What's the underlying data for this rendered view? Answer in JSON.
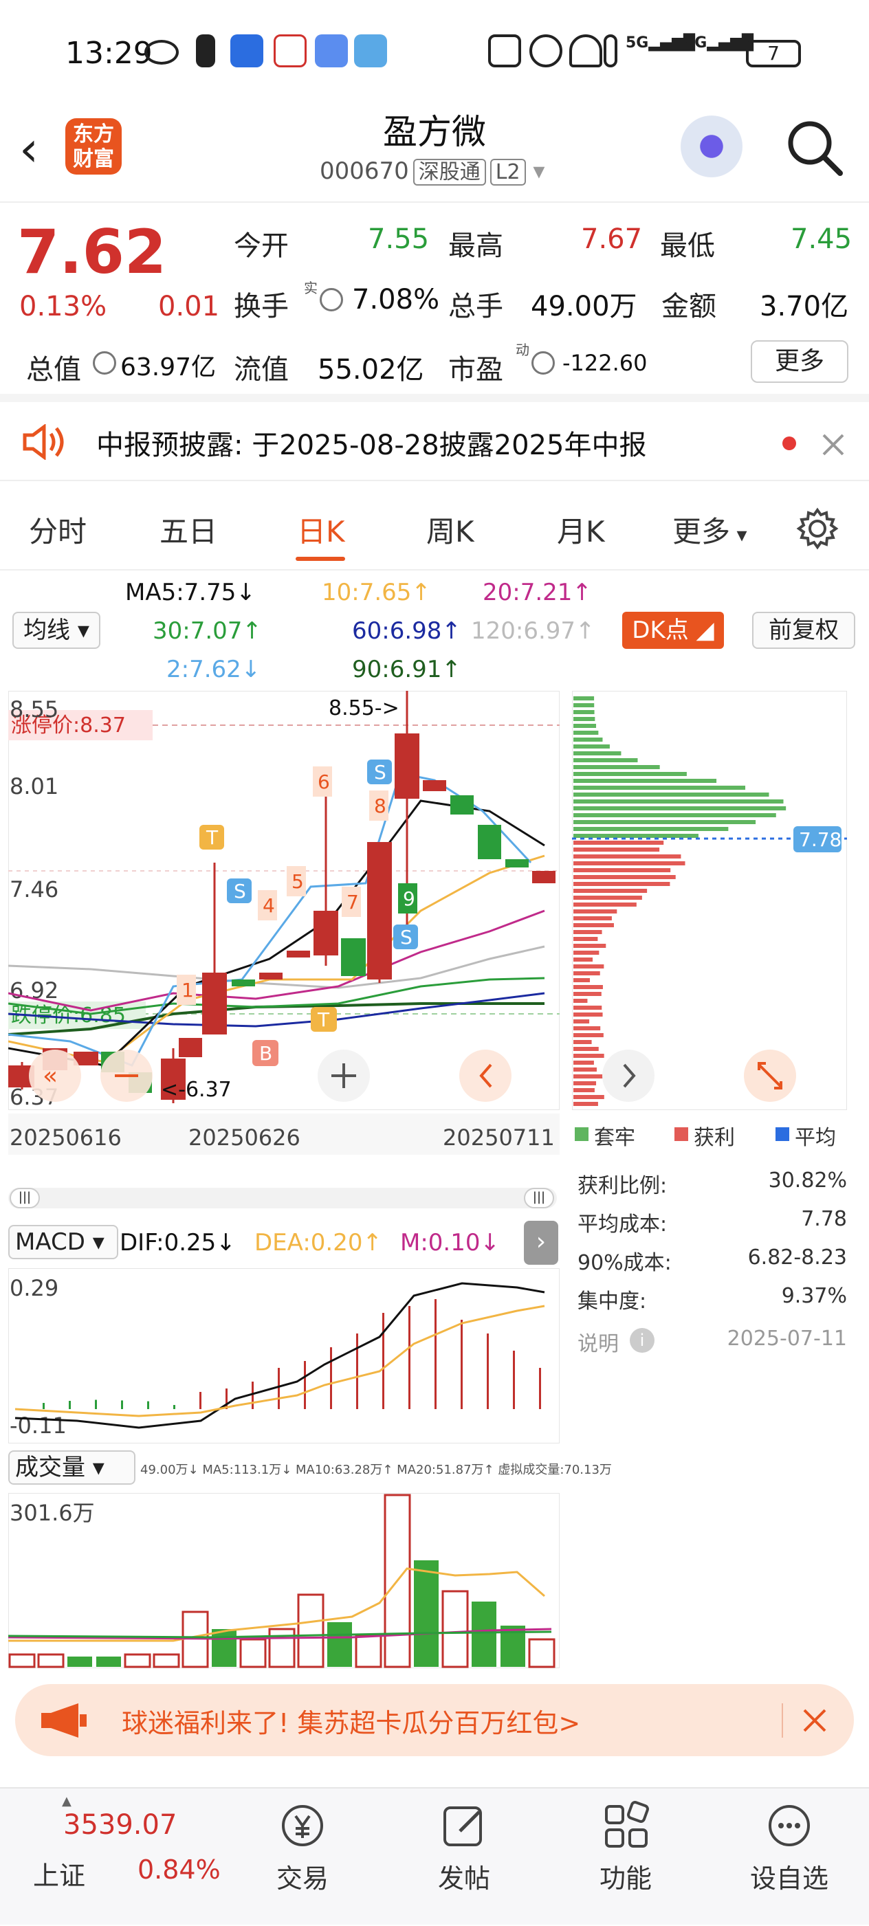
{
  "status_bar": {
    "time": "13:29",
    "battery": "7",
    "network": "5G"
  },
  "header": {
    "title": "盈方微",
    "code": "000670",
    "market_tag": "深股通",
    "level_tag": "L2",
    "logo_text": "东方财富"
  },
  "quote": {
    "price": "7.62",
    "change_pct": "0.13%",
    "change_amt": "0.01",
    "open_label": "今开",
    "open": "7.55",
    "high_label": "最高",
    "high": "7.67",
    "low_label": "最低",
    "low": "7.45",
    "turnover_label": "换手",
    "turnover_sup": "实",
    "turnover": "7.08%",
    "volume_label": "总手",
    "volume": "49.00万",
    "amount_label": "金额",
    "amount": "3.70亿",
    "mktcap_label": "总值",
    "mktcap": "63.97亿",
    "float_label": "流值",
    "float": "55.02亿",
    "pe_label": "市盈",
    "pe_sup": "动",
    "pe": "-122.60",
    "more": "更多"
  },
  "notice": {
    "text": "中报预披露:  于2025-08-28披露2025年中报"
  },
  "tabs": [
    "分时",
    "五日",
    "日K",
    "周K",
    "月K",
    "更多"
  ],
  "active_tab": "日K",
  "ma_panel": {
    "selector": "均线",
    "ma5": "MA5:7.75↓",
    "ma10": "10:7.65↑",
    "ma20": "20:7.21↑",
    "ma30": "30:7.07↑",
    "ma60": "60:6.98↑",
    "ma120": "120:6.97↑",
    "ma2": "2:7.62↓",
    "ma90": "90:6.91↑",
    "dk_button": "DK点",
    "fq_button": "前复权"
  },
  "kchart": {
    "y_top": "8.55",
    "y_mid1": "8.01",
    "y_mid2": "7.46",
    "y_low1": "6.92",
    "y_bottom": "6.37",
    "limit_up": "涨停价:8.37",
    "limit_down": "跌停价:6.85",
    "high_marker": "8.55->",
    "low_marker": "<-6.37",
    "dates": [
      "20250616",
      "20250626",
      "20250711"
    ],
    "signals": [
      "T",
      "S",
      "S",
      "S",
      "B",
      "T",
      "1",
      "4",
      "5",
      "6",
      "7",
      "8",
      "9"
    ]
  },
  "chip": {
    "cost_marker": "7.78",
    "legend": [
      "套牢",
      "获利",
      "平均"
    ],
    "rows": [
      {
        "label": "获利比例:",
        "value": "30.82%"
      },
      {
        "label": "平均成本:",
        "value": "7.78"
      },
      {
        "label": "90%成本:",
        "value": "6.82-8.23"
      },
      {
        "label": "集中度:",
        "value": "9.37%"
      }
    ],
    "note_label": "说明",
    "note_date": "2025-07-11"
  },
  "macd": {
    "selector": "MACD",
    "dif": "DIF:0.25↓",
    "dea": "DEA:0.20↑",
    "m": "M:0.10↓",
    "y_top": "0.29",
    "y_bottom": "-0.11"
  },
  "volume": {
    "selector": "成交量",
    "legend": "49.00万↓ MA5:113.1万↓ MA10:63.28万↑ MA20:51.87万↑ 虚拟成交量:70.13万",
    "y_top": "301.6万"
  },
  "banner": {
    "text": "球迷福利来了! 集苏超卡瓜分百万红包>"
  },
  "bottom_nav": {
    "index_value": "3539.07",
    "index_name": "上证",
    "index_change": "0.84%",
    "items": [
      "交易",
      "发帖",
      "功能",
      "设自选"
    ]
  },
  "colors": {
    "up": "#d0312d",
    "down": "#2a9d3a",
    "accent": "#e8541f"
  }
}
